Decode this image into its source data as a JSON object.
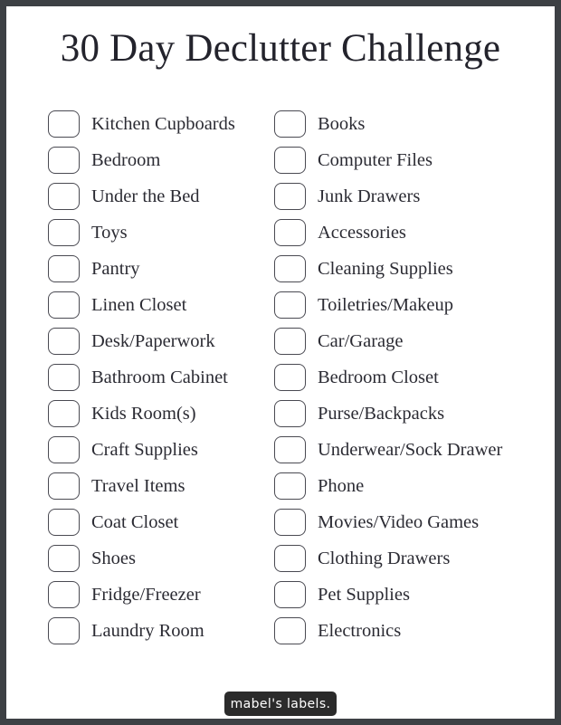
{
  "page": {
    "title": "30 Day Declutter Challenge",
    "background_color": "#ffffff",
    "frame_color": "#3d4044",
    "text_color": "#2b2b33",
    "checkbox_border_color": "#4a4a52"
  },
  "checklist": {
    "columns": [
      {
        "name": "left-column",
        "items": [
          {
            "label": "Kitchen Cupboards",
            "checked": false
          },
          {
            "label": "Bedroom",
            "checked": false
          },
          {
            "label": "Under the Bed",
            "checked": false
          },
          {
            "label": "Toys",
            "checked": false
          },
          {
            "label": "Pantry",
            "checked": false
          },
          {
            "label": "Linen Closet",
            "checked": false
          },
          {
            "label": "Desk/Paperwork",
            "checked": false
          },
          {
            "label": "Bathroom Cabinet",
            "checked": false
          },
          {
            "label": "Kids Room(s)",
            "checked": false
          },
          {
            "label": "Craft Supplies",
            "checked": false
          },
          {
            "label": "Travel Items",
            "checked": false
          },
          {
            "label": "Coat Closet",
            "checked": false
          },
          {
            "label": "Shoes",
            "checked": false
          },
          {
            "label": "Fridge/Freezer",
            "checked": false
          },
          {
            "label": "Laundry Room",
            "checked": false
          }
        ]
      },
      {
        "name": "right-column",
        "items": [
          {
            "label": "Books",
            "checked": false
          },
          {
            "label": "Computer Files",
            "checked": false
          },
          {
            "label": "Junk Drawers",
            "checked": false
          },
          {
            "label": "Accessories",
            "checked": false
          },
          {
            "label": "Cleaning Supplies",
            "checked": false
          },
          {
            "label": "Toiletries/Makeup",
            "checked": false
          },
          {
            "label": "Car/Garage",
            "checked": false
          },
          {
            "label": "Bedroom Closet",
            "checked": false
          },
          {
            "label": "Purse/Backpacks",
            "checked": false
          },
          {
            "label": "Underwear/Sock Drawer",
            "checked": false
          },
          {
            "label": "Phone",
            "checked": false
          },
          {
            "label": "Movies/Video Games",
            "checked": false
          },
          {
            "label": "Clothing Drawers",
            "checked": false
          },
          {
            "label": "Pet Supplies",
            "checked": false
          },
          {
            "label": "Electronics",
            "checked": false
          }
        ]
      }
    ]
  },
  "footer": {
    "logo_text": "mabel's labels.",
    "logo_background": "#2b2b2b",
    "logo_text_color": "#ffffff"
  }
}
